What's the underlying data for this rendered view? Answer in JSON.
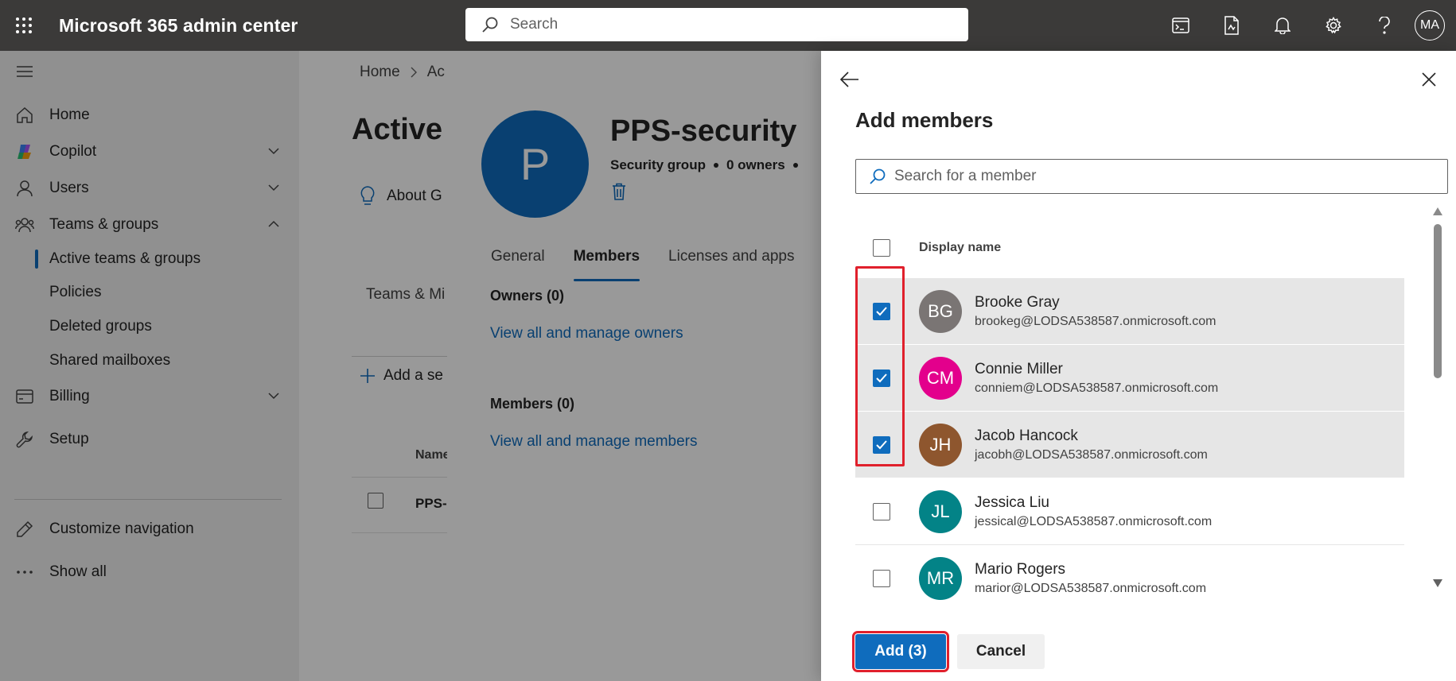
{
  "app": {
    "title": "Microsoft 365 admin center",
    "search_placeholder": "Search",
    "user_initials": "MA"
  },
  "leftnav": {
    "items": [
      {
        "label": "Home",
        "icon": "home-icon"
      },
      {
        "label": "Copilot",
        "icon": "copilot-icon"
      },
      {
        "label": "Users",
        "icon": "user-icon"
      },
      {
        "label": "Teams & groups",
        "icon": "people-icon"
      }
    ],
    "sub_items": [
      {
        "label": "Active teams & groups",
        "active": true
      },
      {
        "label": "Policies"
      },
      {
        "label": "Deleted groups"
      },
      {
        "label": "Shared mailboxes"
      }
    ],
    "billing": "Billing",
    "setup": "Setup",
    "customize": "Customize navigation",
    "show_all": "Show all"
  },
  "main": {
    "breadcrumb_home": "Home",
    "breadcrumb_current": "Ac",
    "page_title": "Active",
    "about": "About G",
    "teams_tab": "Teams & Mi",
    "add_action": "Add a se",
    "name_column": "Name",
    "row_name": "PPS-"
  },
  "group": {
    "avatar_letter": "P",
    "name": "PPS-security",
    "type": "Security group",
    "owners": "0 owners",
    "tabs": [
      "General",
      "Members",
      "Licenses and apps"
    ],
    "owners_heading": "Owners (0)",
    "owners_link": "View all and manage owners",
    "members_heading": "Members (0)",
    "members_link": "View all and manage members"
  },
  "add_members": {
    "title": "Add members",
    "search_placeholder": "Search for a member",
    "column_display_name": "Display name",
    "members": [
      {
        "initials": "BG",
        "name": "Brooke Gray",
        "email": "brookeg@LODSA538587.onmicrosoft.com",
        "color": "#7a7574",
        "checked": true
      },
      {
        "initials": "CM",
        "name": "Connie Miller",
        "email": "conniem@LODSA538587.onmicrosoft.com",
        "color": "#e3008c",
        "checked": true
      },
      {
        "initials": "JH",
        "name": "Jacob Hancock",
        "email": "jacobh@LODSA538587.onmicrosoft.com",
        "color": "#8e562e",
        "checked": true
      },
      {
        "initials": "JL",
        "name": "Jessica Liu",
        "email": "jessical@LODSA538587.onmicrosoft.com",
        "color": "#038387",
        "checked": false
      },
      {
        "initials": "MR",
        "name": "Mario Rogers",
        "email": "marior@LODSA538587.onmicrosoft.com",
        "color": "#038387",
        "checked": false
      }
    ],
    "add_button": "Add (3)",
    "cancel_button": "Cancel"
  }
}
